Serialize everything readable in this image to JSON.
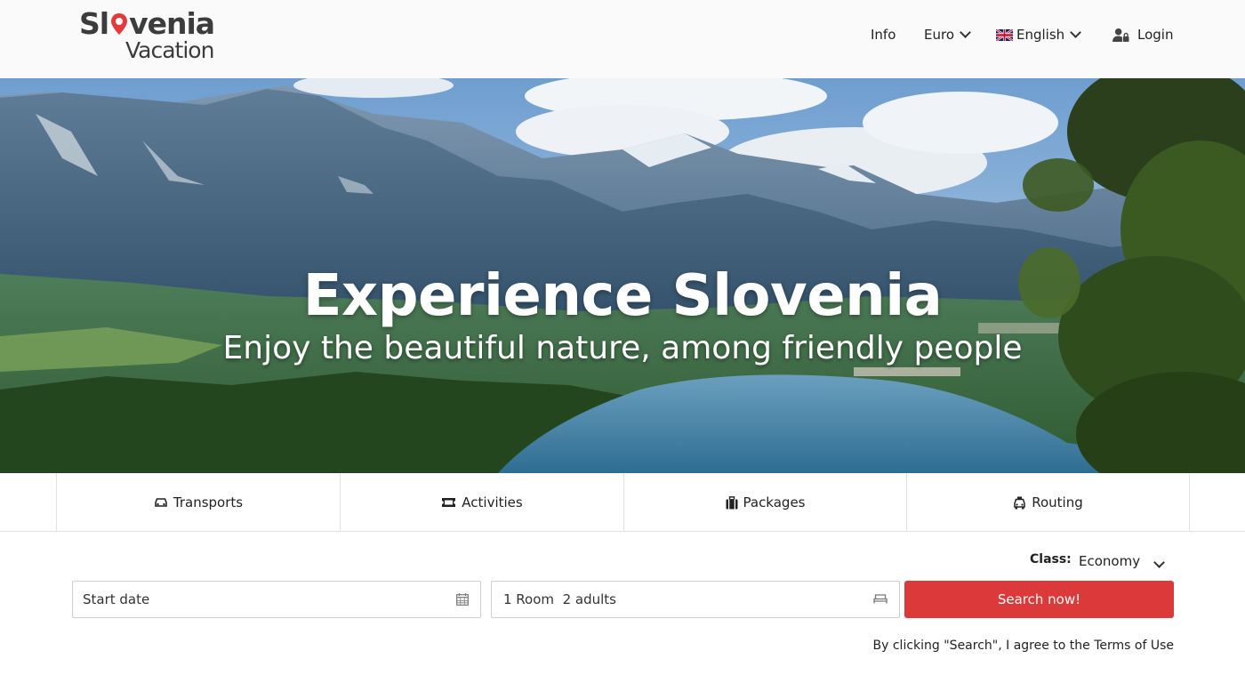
{
  "header": {
    "logo": {
      "line1_part1": "Sl",
      "line1_part2": "venia",
      "line2": "Vacation"
    },
    "nav": {
      "info": "Info",
      "currency": "Euro",
      "language": "English",
      "login": "Login"
    },
    "icons": {
      "flag": "uk-flag-icon",
      "login": "user-lock-icon",
      "dropdown": "chevron-down-icon"
    }
  },
  "hero": {
    "title": "Experience Slovenia",
    "subtitle": "Enjoy the beautiful nature, among friendly people"
  },
  "tabs": [
    {
      "label": "Transports",
      "icon": "car-icon"
    },
    {
      "label": "Activities",
      "icon": "ticket-icon"
    },
    {
      "label": "Packages",
      "icon": "luggage-icon"
    },
    {
      "label": "Routing",
      "icon": "taxi-icon"
    }
  ],
  "search": {
    "class_label": "Class:",
    "class_value": "Economy",
    "start_date_placeholder": "Start date",
    "rooms_value": "1 Room  2 adults",
    "button_label": "Search now!",
    "terms_text": "By clicking \"Search\", I agree to the Terms of Use"
  },
  "colors": {
    "accent": "#dc3a3a",
    "logo_pin": "#e23b3b",
    "header_bg": "#fafafa",
    "text": "#222222",
    "border": "#e2e2e2"
  }
}
